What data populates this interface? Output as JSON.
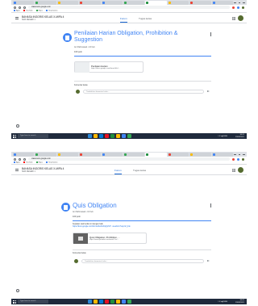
{
  "browser": {
    "url": "classroom.google.com",
    "bookmarks": [
      "Apps",
      "YouTube",
      "Maps",
      "Terjemahan"
    ],
    "tab_colors": [
      "#4285f4",
      "#34a853",
      "#fbbc04",
      "#ea4335",
      "#4285f4",
      "#34a853",
      "#4285f4",
      "#fbbc04",
      "#ea4335",
      "#4285f4",
      "#34a853",
      "#4285f4"
    ]
  },
  "class": {
    "name": "BAHASA INGGRIS KELAS X-MIPA 4",
    "subtitle": "SMA NEGERI 1",
    "tabs": [
      "Forum",
      "Tugas kelas"
    ]
  },
  "screenshot_1": {
    "title_line_1": "Penilaian Harian Obligation, Prohibition &",
    "title_line_2": "Suggestion",
    "meta": "Ani Rahmawati • 16 Feb",
    "points": "100 poin",
    "attachment": {
      "title": "Penilaian Harian",
      "subtitle": "https://docs.google.com/forms/d/e/..."
    },
    "comments_label": "Komentar kelas",
    "comment_placeholder": "Tambahkan komentar kelas..."
  },
  "screenshot_2": {
    "title": "Quis Obligation",
    "meta": "Ani Rahmawati • 10 Feb",
    "points": "100 poin",
    "description_line_1": "Kerjakan soal berikut ini dengan baik.",
    "description_line_2": "https://docs.google.com/forms/d/e/1FAIpQLSf7...viewform?usp=sf_link",
    "attachment": {
      "title": "Quis Obligation, Prohibition, ...",
      "subtitle": "https://www.youtube.com/watch?v=..."
    },
    "comments_label": "Komentar kelas",
    "comment_placeholder": "Tambahkan komentar kelas..."
  },
  "taskbar": {
    "search_placeholder": "Type here to search",
    "time": "10:21",
    "date": "23/02/2021",
    "tray": "^ ✉ ◀) ENG",
    "app_colors": [
      "#2b88d8",
      "#ffb900",
      "#0078d7",
      "#e81123",
      "#1e8e3e",
      "#fbbc04",
      "#4285f4",
      "#34a853"
    ]
  },
  "colors": {
    "accent": "#4285f4",
    "active_tab": "#1967d2",
    "taskbar": "#1f2a3c"
  }
}
